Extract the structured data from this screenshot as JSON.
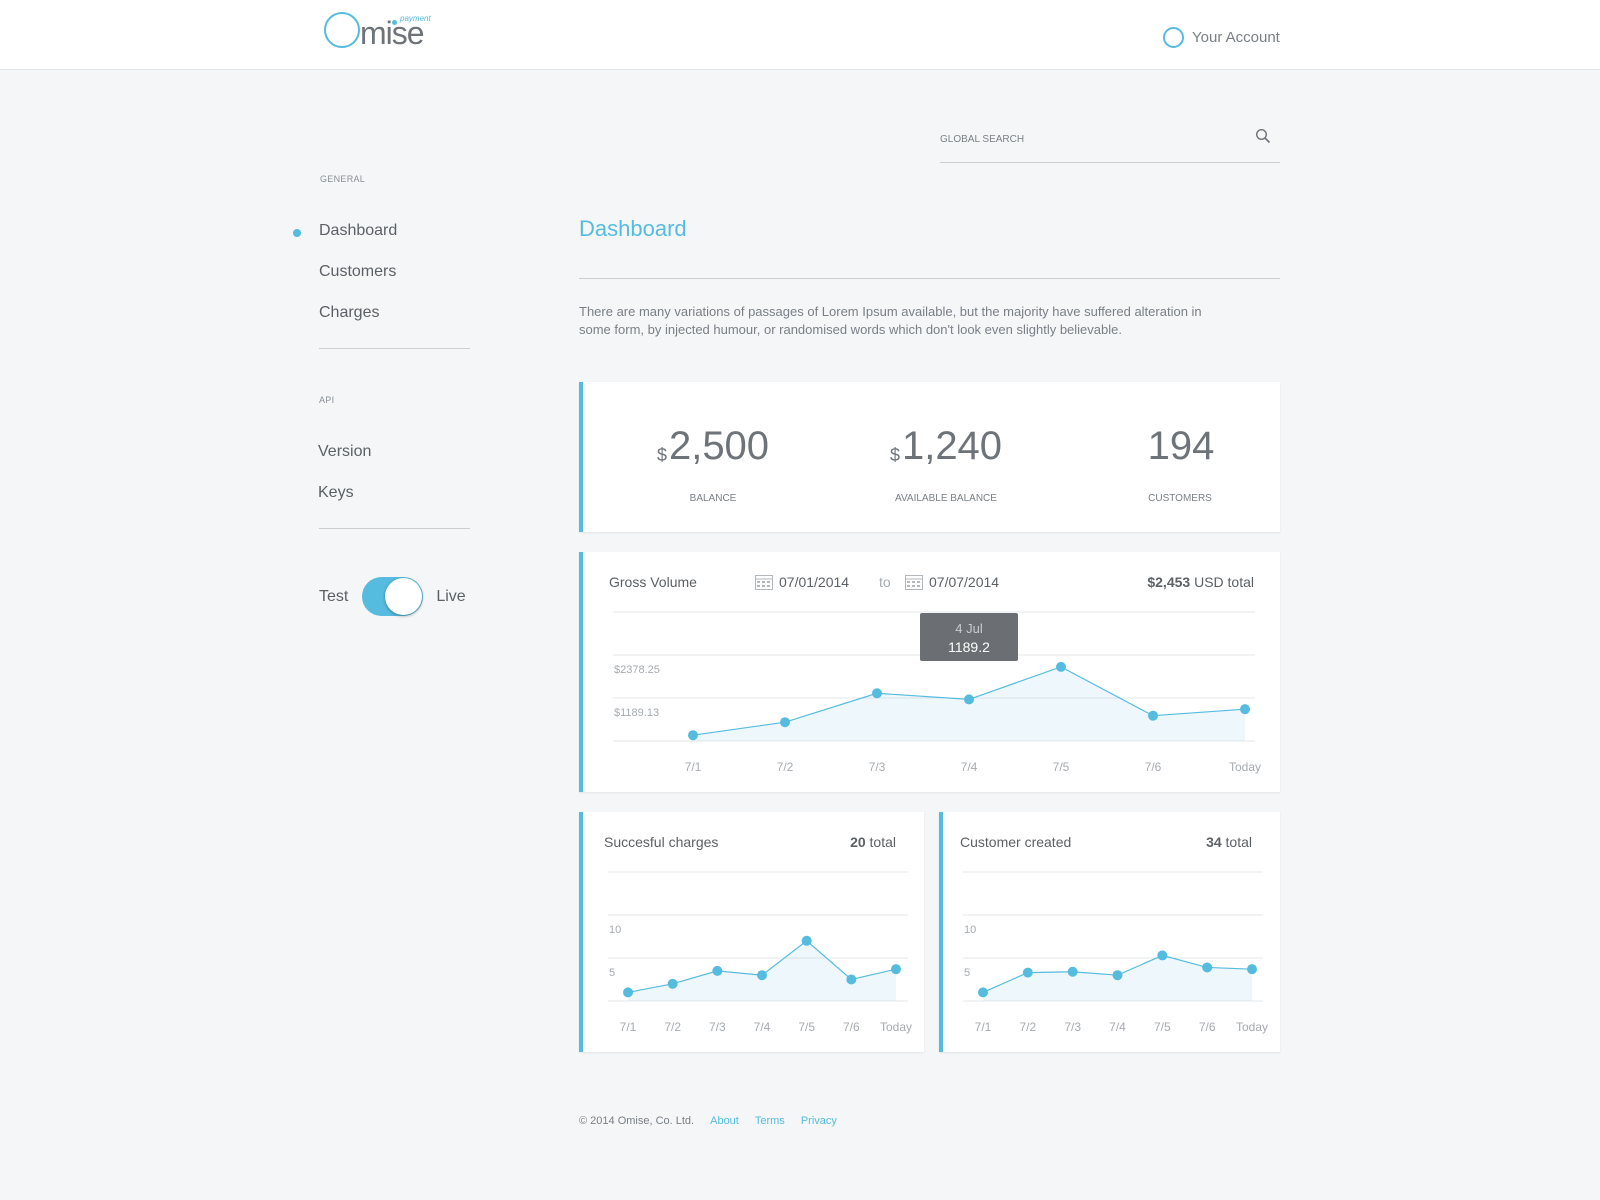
{
  "header": {
    "logo_text": "mise",
    "logo_sup": "payment",
    "account_label": "Your Account"
  },
  "search": {
    "placeholder": "GLOBAL SEARCH"
  },
  "sidebar": {
    "general_heading": "GENERAL",
    "general_items": [
      "Dashboard",
      "Customers",
      "Charges"
    ],
    "api_heading": "API",
    "api_items": [
      "Version",
      "Keys"
    ],
    "mode": {
      "left": "Test",
      "right": "Live",
      "live_on": true
    }
  },
  "main": {
    "title": "Dashboard",
    "intro": "There are many variations of passages of Lorem Ipsum available, but the majority have suffered alteration in some form, by injected humour, or randomised words which don't look even slightly believable."
  },
  "stats": [
    {
      "currency": "$",
      "value": "2,500",
      "label": "BALANCE"
    },
    {
      "currency": "$",
      "value": "1,240",
      "label": "AVAILABLE BALANCE"
    },
    {
      "currency": "",
      "value": "194",
      "label": "CUSTOMERS"
    }
  ],
  "gross": {
    "title": "Gross Volume",
    "from": "07/01/2014",
    "to_label": "to",
    "to": "07/07/2014",
    "total_amount": "$2,453",
    "total_suffix": "USD total",
    "tooltip_date": "4 Jul",
    "tooltip_value": "1189.2"
  },
  "charges": {
    "title": "Succesful charges",
    "total_amount": "20",
    "total_suffix": "total"
  },
  "customers": {
    "title": "Customer created",
    "total_amount": "34",
    "total_suffix": "total"
  },
  "colors": {
    "accent": "#55bcdf",
    "background": "#f4f6f8",
    "tooltip": "#6b6e72"
  },
  "chart_data": [
    {
      "type": "area",
      "title": "Gross Volume",
      "categories": [
        "7/1",
        "7/2",
        "7/3",
        "7/4",
        "7/5",
        "7/6",
        "Today"
      ],
      "y_ticks": [
        2378.25,
        1189.13
      ],
      "y_tick_labels": [
        "$2378.25",
        "$1189.13"
      ],
      "ylim": [
        0,
        3567
      ],
      "values": [
        160,
        520,
        1320,
        1150,
        2050,
        700,
        880
      ],
      "grid": true
    },
    {
      "type": "area",
      "title": "Succesful charges",
      "categories": [
        "7/1",
        "7/2",
        "7/3",
        "7/4",
        "7/5",
        "7/6",
        "Today"
      ],
      "y_ticks": [
        10,
        5
      ],
      "y_tick_labels": [
        "10",
        "5"
      ],
      "ylim": [
        0,
        15
      ],
      "values": [
        1,
        2,
        3.5,
        3,
        7,
        2.5,
        3.7
      ],
      "grid": true
    },
    {
      "type": "area",
      "title": "Customer created",
      "categories": [
        "7/1",
        "7/2",
        "7/3",
        "7/4",
        "7/5",
        "7/6",
        "Today"
      ],
      "y_ticks": [
        10,
        5
      ],
      "y_tick_labels": [
        "10",
        "5"
      ],
      "ylim": [
        0,
        15
      ],
      "values": [
        1,
        3.3,
        3.4,
        3,
        5.3,
        3.9,
        3.7
      ],
      "grid": true
    }
  ],
  "footer": {
    "copyright": "© 2014 Omise, Co. Ltd.",
    "links": [
      "About",
      "Terms",
      "Privacy"
    ]
  }
}
